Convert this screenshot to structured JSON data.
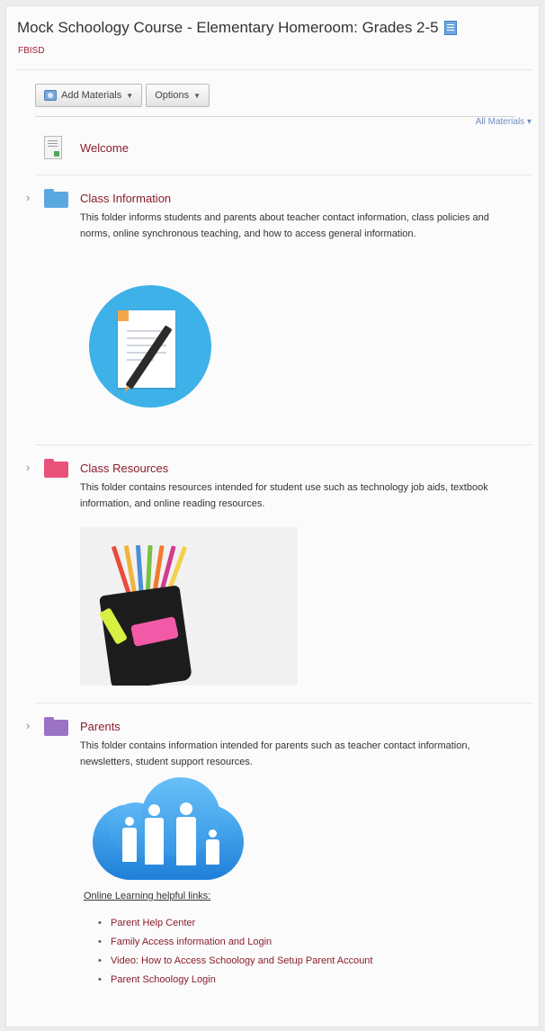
{
  "course": {
    "title": "Mock Schoology Course - Elementary Homeroom: Grades 2-5",
    "org": "FBISD"
  },
  "toolbar": {
    "add_materials": "Add Materials",
    "options": "Options",
    "all_materials": "All Materials"
  },
  "items": [
    {
      "title": "Welcome",
      "icon": "document-icon"
    },
    {
      "title": "Class Information",
      "color": "#5aa8e0",
      "description": "This folder informs students and parents about teacher contact information, class policies and norms, online synchronous teaching, and how to access general information."
    },
    {
      "title": "Class Resources",
      "color": "#e8527a",
      "description": "This folder contains resources intended for student use such as technology job aids, textbook information, and online reading resources."
    },
    {
      "title": "Parents",
      "color": "#9b73c5",
      "description": "This folder contains information intended for parents such as teacher contact information, newsletters, student support resources."
    }
  ],
  "links": {
    "heading": "Online Learning helpful links:",
    "items": [
      "Parent Help Center",
      "Family Access information and Login",
      "Video: How to Access Schoology and Setup Parent Account",
      "Parent Schoology Login"
    ]
  }
}
